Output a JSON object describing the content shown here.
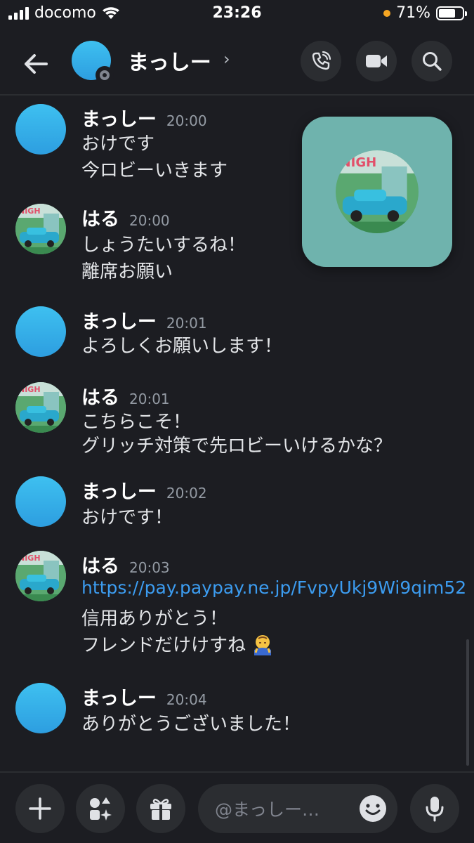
{
  "status_bar": {
    "carrier": "docomo",
    "time": "23:26",
    "battery": "71%",
    "battery_level": 0.71
  },
  "header": {
    "name": "まっしー",
    "chevron": "›",
    "icons": [
      "back-arrow-icon",
      "voice-call-icon",
      "video-call-icon",
      "search-icon"
    ]
  },
  "messages": [
    {
      "author": "まっしー",
      "time": "20:00",
      "avatar": "blue-avatar",
      "lines": [
        "おけです",
        "今ロビーいきます"
      ]
    },
    {
      "author": "はる",
      "time": "20:00",
      "avatar": "art-avatar",
      "lines": [
        "しょうたいするね！",
        "離席お願い"
      ]
    },
    {
      "author": "まっしー",
      "time": "20:01",
      "avatar": "blue-avatar",
      "lines": [
        "よろしくお願いします！"
      ]
    },
    {
      "author": "はる",
      "time": "20:01",
      "avatar": "art-avatar",
      "lines": [
        "こちらこそ！",
        "グリッチ対策で先ロビーいけるかな？"
      ]
    },
    {
      "author": "まっしー",
      "time": "20:02",
      "avatar": "blue-avatar",
      "lines": [
        "おけです！"
      ]
    },
    {
      "author": "はる",
      "time": "20:03",
      "avatar": "art-avatar",
      "link": "https://pay.paypay.ne.jp/FvpyUkj9Wi9qim52",
      "lines": [
        "信用ありがとう！",
        "フレンドだけけすね"
      ]
    },
    {
      "author": "まっしー",
      "time": "20:04",
      "avatar": "blue-avatar",
      "lines": [
        "ありがとうございました！"
      ]
    }
  ],
  "composer": {
    "placeholder": "@まっしー…",
    "icons": [
      "plus-icon",
      "apps-icon",
      "gift-icon",
      "emoji-icon",
      "microphone-icon"
    ]
  },
  "colors": {
    "background": "#1c1d22",
    "avatar_blue": "#3ec0f0",
    "link": "#3c9cf0",
    "pip_background": "#6fb3ad"
  }
}
